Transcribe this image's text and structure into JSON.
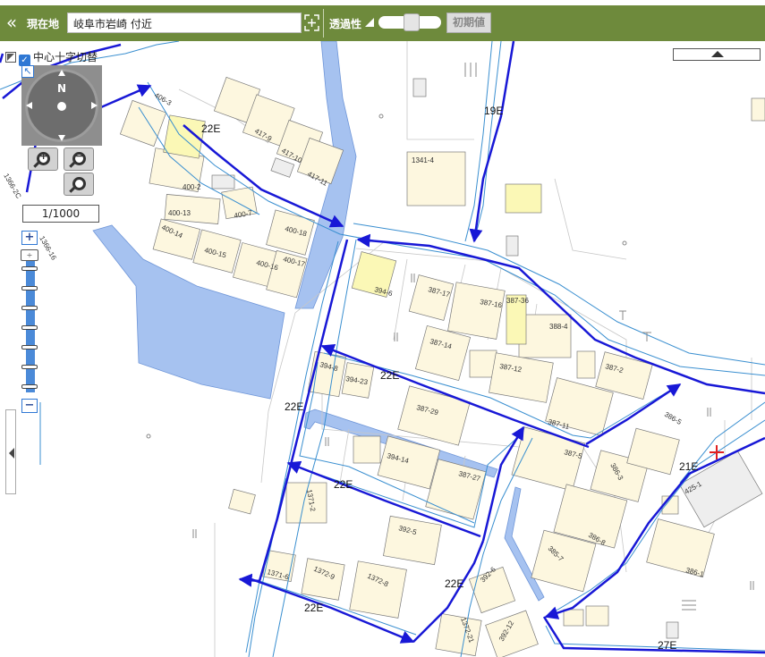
{
  "topbar": {
    "collapse_icon": "«",
    "location_label": "現在地",
    "location_value": "岐阜市岩崎 付近",
    "transparency_label": "透過性",
    "reset_button": "初期値"
  },
  "controls": {
    "center_cross_toggle": "中心十字切替",
    "center_cross_checked": true,
    "compass_north": "N",
    "scale": "1/1000",
    "zoom_plus": "+",
    "zoom_minus": "−",
    "zoom_handle_glyph": "÷"
  },
  "colors": {
    "topbar": "#6e8a3c",
    "road_arrow": "#1818d6",
    "road_edge": "#3a8fd0",
    "water": "#a6c2f0",
    "building": "#fdf7df",
    "building_highlight": "#fbf8b6",
    "gray_building": "#eeeeee"
  },
  "map": {
    "road_labels": [
      "22E",
      "19E",
      "22E",
      "22E",
      "22E",
      "21E",
      "22E",
      "22E",
      "27E"
    ],
    "parcels": [
      "406-3",
      "417-9",
      "417-10",
      "417-11",
      "400-2",
      "400-13",
      "400-7",
      "1366-2C",
      "1366-16",
      "400-14",
      "400-15",
      "400-16",
      "400-18",
      "400-17",
      "1341-4",
      "394-6",
      "387-17",
      "387-16",
      "387-36",
      "388-4",
      "387-14",
      "387-12",
      "387-2",
      "387-11",
      "394-8",
      "394-23",
      "387-29",
      "394-14",
      "387-27",
      "387-5",
      "386-3",
      "386-5",
      "425-1",
      "1371-2",
      "392-5",
      "386-8",
      "385-7",
      "386-1",
      "1371-6",
      "1372-9",
      "1372-8",
      "392-6",
      "1372-21",
      "392-12"
    ]
  }
}
